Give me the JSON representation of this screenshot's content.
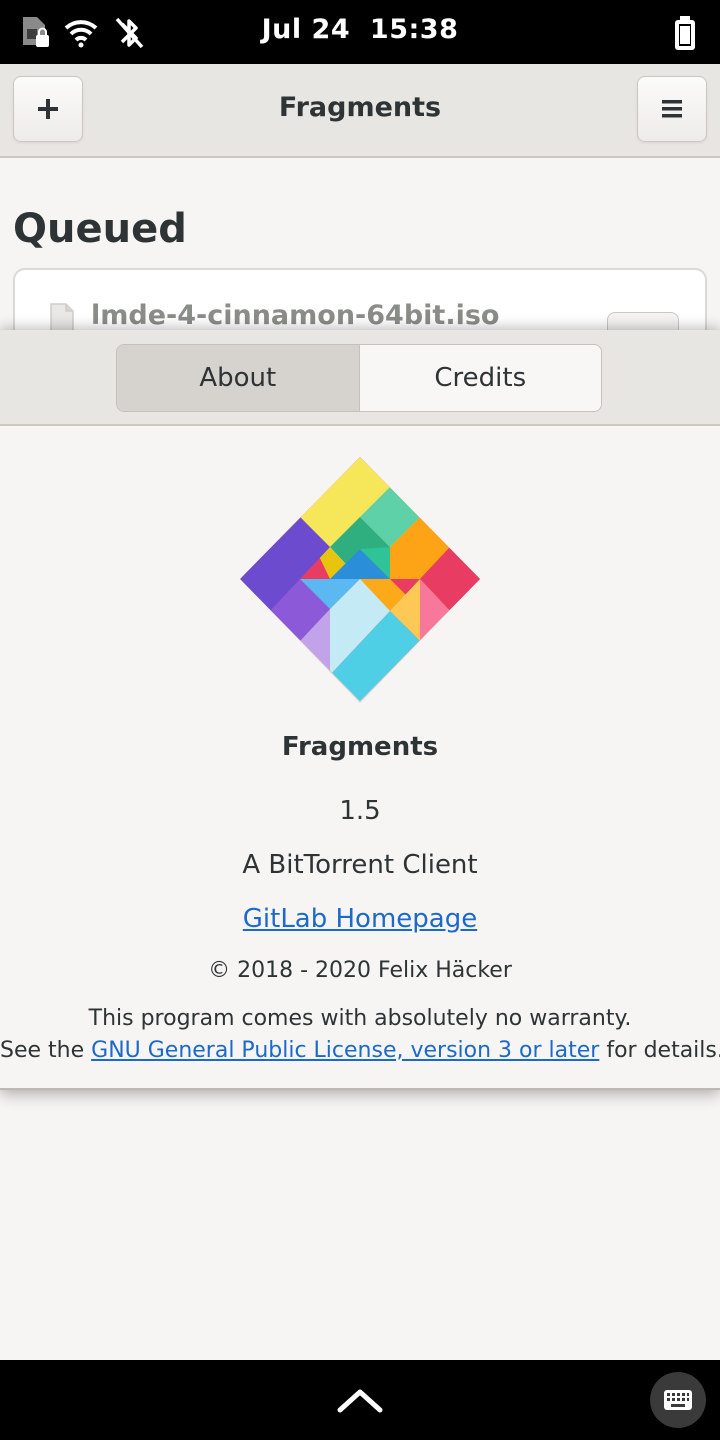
{
  "status_bar": {
    "date": "Jul 24",
    "time": "15:38",
    "icons": [
      "sim-card-locked-icon",
      "wifi-icon",
      "bluetooth-disabled-icon",
      "battery-icon"
    ]
  },
  "header": {
    "title": "Fragments",
    "add_button_icon": "plus-icon",
    "menu_button_icon": "hamburger-menu-icon"
  },
  "main": {
    "section_title": "Queued",
    "torrents": [
      {
        "name": "lmde-4-cinnamon-64bit.iso"
      }
    ]
  },
  "about_dialog": {
    "tabs": [
      {
        "label": "About",
        "active": true
      },
      {
        "label": "Credits",
        "active": false
      }
    ],
    "app_name": "Fragments",
    "version": "1.5",
    "comments": "A BitTorrent Client",
    "website_label": "GitLab Homepage",
    "copyright": "© 2018 - 2020 Felix Häcker",
    "license_line1": "This program comes with absolutely no warranty.",
    "license_prefix": "See the ",
    "license_link": "GNU General Public License, version 3 or later",
    "license_suffix": " for details."
  },
  "bottom_bar": {
    "icons": [
      "chevron-up-icon",
      "keyboard-icon"
    ]
  },
  "colors": {
    "link": "#1b6acb",
    "background": "#f6f5f4",
    "headerbar": "#e8e6e3"
  }
}
